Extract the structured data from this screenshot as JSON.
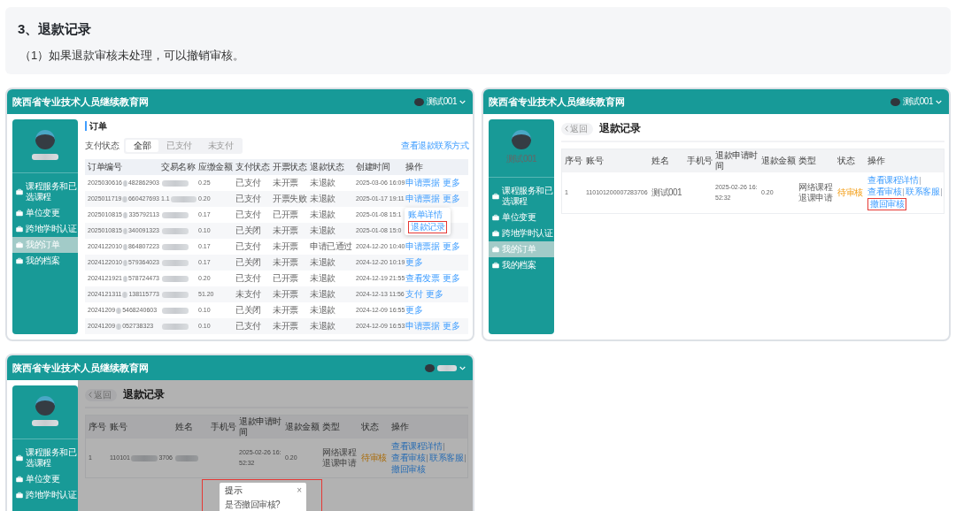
{
  "section": {
    "heading": "3、退款记录",
    "note": "（1）如果退款审核未处理，可以撤销审核。"
  },
  "screens": [
    {
      "kind": "orders",
      "site_title": "陕西省专业技术人员继续教育网",
      "account": {
        "text": "测试001",
        "blur": false
      },
      "sidebar": {
        "user": {
          "blur": true
        },
        "items": [
          {
            "label": "课程服务和已选课程",
            "selected": false
          },
          {
            "label": "单位变更",
            "selected": false
          },
          {
            "label": "跨地学时认证",
            "selected": false
          },
          {
            "label": "我的订单",
            "selected": true
          },
          {
            "label": "我的档案",
            "selected": false
          }
        ]
      },
      "page": {
        "title": "订单",
        "filter": {
          "label": "支付状态",
          "options": [
            {
              "label": "全部",
              "selected": true
            },
            {
              "label": "已支付",
              "selected": false
            },
            {
              "label": "未支付",
              "selected": false
            }
          ]
        },
        "contact_link": "查看退款联系方式",
        "table": {
          "columns": [
            "订单编号",
            "交易名称",
            "应缴金额",
            "支付状态",
            "开票状态",
            "退款状态",
            "创建时间",
            "操作"
          ],
          "rows": [
            {
              "order_no": {
                "text": "2025030616",
                "blur": true,
                "tail": "482862903"
              },
              "item": {
                "blur": true
              },
              "amount": "0.25",
              "pay_status": "已支付",
              "invoice_status": "未开票",
              "refund_status": "未退款",
              "created": "2025-03-06 16:09",
              "actions": [
                "申请票据",
                "更多"
              ]
            },
            {
              "order_no": {
                "text": "2025011719",
                "blur": true,
                "tail": "660427693"
              },
              "item": {
                "text": "1.1",
                "blur": true
              },
              "amount": "0.20",
              "pay_status": "已支付",
              "invoice_status": "开票失败",
              "refund_status": "未退款",
              "created": "2025-01-17 19:11",
              "actions": [
                "申请票据",
                "更多"
              ]
            },
            {
              "order_no": {
                "text": "2025010815",
                "blur": true,
                "tail": "335792113"
              },
              "item": {
                "blur": true
              },
              "amount": "0.17",
              "pay_status": "已支付",
              "invoice_status": "已开票",
              "refund_status": "未退款",
              "created": "2025-01-08 15:1",
              "popover": {
                "items": [
                  {
                    "label": "账单详情",
                    "highlighted": false
                  },
                  {
                    "label": "退款记录",
                    "highlighted": true
                  }
                ]
              }
            },
            {
              "order_no": {
                "text": "2025010815",
                "blur": true,
                "tail": "340091323"
              },
              "item": {
                "blur": true
              },
              "amount": "0.10",
              "pay_status": "已关闭",
              "invoice_status": "未开票",
              "refund_status": "未退款",
              "created": "2025-01-08 15:0"
            },
            {
              "order_no": {
                "text": "2024122010",
                "blur": true,
                "tail": "864807223"
              },
              "item": {
                "blur": true
              },
              "amount": "0.17",
              "pay_status": "已支付",
              "invoice_status": "未开票",
              "refund_status": "申请已通过",
              "created": "2024-12-20 10:40",
              "actions": [
                "申请票据",
                "更多"
              ]
            },
            {
              "order_no": {
                "text": "2024122010",
                "blur": true,
                "tail": "579364023"
              },
              "item": {
                "blur": true
              },
              "amount": "0.17",
              "pay_status": "已关闭",
              "invoice_status": "未开票",
              "refund_status": "未退款",
              "created": "2024-12-20 10:19",
              "actions": [
                "更多"
              ]
            },
            {
              "order_no": {
                "text": "2024121921",
                "blur": true,
                "tail": "578724473"
              },
              "item": {
                "blur": true
              },
              "amount": "0.20",
              "pay_status": "已支付",
              "invoice_status": "已开票",
              "refund_status": "未退款",
              "created": "2024-12-19 21:55",
              "actions": [
                "查看发票",
                "更多"
              ]
            },
            {
              "order_no": {
                "text": "2024121311",
                "blur": true,
                "tail": "138115773"
              },
              "item": {
                "blur": true
              },
              "amount": "51.20",
              "pay_status": "未支付",
              "invoice_status": "未开票",
              "refund_status": "未退款",
              "created": "2024-12-13 11:56",
              "actions": [
                "支付",
                "更多"
              ]
            },
            {
              "order_no": {
                "text": "20241209",
                "blur": true,
                "tail": "5468240603"
              },
              "item": {
                "blur": true
              },
              "amount": "0.10",
              "pay_status": "已关闭",
              "invoice_status": "未开票",
              "refund_status": "未退款",
              "created": "2024-12-09 16:55",
              "actions": [
                "更多"
              ]
            },
            {
              "order_no": {
                "text": "20241209",
                "blur": true,
                "tail": "052738323"
              },
              "item": {
                "blur": true
              },
              "amount": "0.10",
              "pay_status": "已支付",
              "invoice_status": "未开票",
              "refund_status": "未退款",
              "created": "2024-12-09 16:53",
              "actions": [
                "申请票据",
                "更多"
              ]
            }
          ]
        }
      }
    },
    {
      "kind": "refunds",
      "site_title": "陕西省专业技术人员继续教育网",
      "account": {
        "text": "测试001",
        "blur": false
      },
      "sidebar": {
        "user": {
          "text": "测试001",
          "blur": false
        },
        "items": [
          {
            "label": "课程服务和已选课程",
            "selected": false
          },
          {
            "label": "单位变更",
            "selected": false
          },
          {
            "label": "跨地学时认证",
            "selected": false
          },
          {
            "label": "我的订单",
            "selected": true
          },
          {
            "label": "我的档案",
            "selected": false
          }
        ]
      },
      "page": {
        "back": "返回",
        "title": "退款记录",
        "modal_mask": false,
        "table": {
          "columns": [
            "序号",
            "账号",
            "姓名",
            "手机号",
            "退款申请时间",
            "退款金额",
            "类型",
            "状态",
            "操作"
          ],
          "rows": [
            {
              "index": "1",
              "account": {
                "text": "110101200007283706",
                "blur": false
              },
              "name": {
                "text": "测试001",
                "blur": false
              },
              "applied_at": "2025-02-26 16:52:32",
              "amount": "0.20",
              "type": "网络课程退课申请",
              "status": "待审核",
              "actions": [
                {
                  "label": "查看课程详情",
                  "highlighted": false
                },
                {
                  "label": "查看审核",
                  "highlighted": false
                },
                {
                  "label": "联系客服",
                  "highlighted": false
                },
                {
                  "label": "撤回审核",
                  "highlighted": true
                }
              ]
            }
          ]
        }
      }
    },
    {
      "kind": "refunds",
      "site_title": "陕西省专业技术人员继续教育网",
      "account": {
        "blur": true
      },
      "sidebar": {
        "user": {
          "blur": true
        },
        "items": [
          {
            "label": "课程服务和已选课程",
            "selected": false
          },
          {
            "label": "单位变更",
            "selected": false
          },
          {
            "label": "跨地学时认证",
            "selected": false
          }
        ]
      },
      "page": {
        "back": "返回",
        "title": "退款记录",
        "modal_mask": true,
        "table": {
          "columns": [
            "序号",
            "账号",
            "姓名",
            "手机号",
            "退款申请时间",
            "退款金额",
            "类型",
            "状态",
            "操作"
          ],
          "rows": [
            {
              "index": "1",
              "account": {
                "text": "110101",
                "blur": true,
                "tail": "3706"
              },
              "name": {
                "blur": true
              },
              "applied_at": "2025-02-26 16:52:32",
              "amount": "0.20",
              "type": "网络课程退课申请",
              "status": "待审核",
              "actions": [
                {
                  "label": "查看课程详情",
                  "highlighted": false
                },
                {
                  "label": "查看审核",
                  "highlighted": false
                },
                {
                  "label": "联系客服",
                  "highlighted": false
                },
                {
                  "label": "撤回审核",
                  "highlighted": false
                }
              ]
            }
          ]
        },
        "dialog": {
          "title": "提示",
          "close": "×",
          "message": "是否撤回审核?",
          "highlighted": true
        }
      }
    }
  ]
}
